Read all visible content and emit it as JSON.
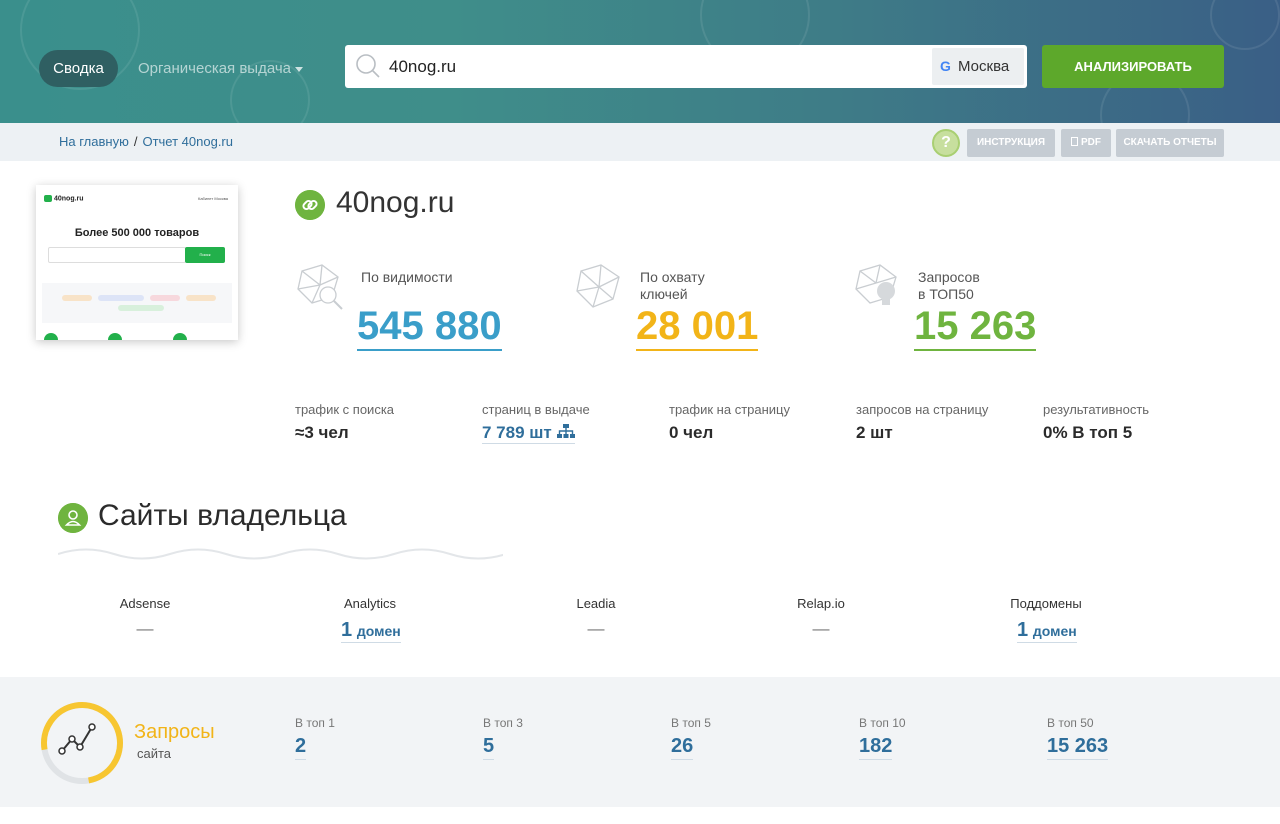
{
  "header": {
    "tab_summary": "Сводка",
    "tab_organic": "Органическая выдача",
    "search_value": "40nog.ru",
    "region_label": "Москва",
    "analyze_label": "АНАЛИЗИРОВАТЬ"
  },
  "breadcrumbs": {
    "home": "На главную",
    "separator": "/",
    "current": "Отчет 40nog.ru"
  },
  "toolbar": {
    "help": "?",
    "instruction": "ИНСТРУКЦИЯ",
    "pdf": "PDF",
    "download": "СКАЧАТЬ ОТЧЕТЫ"
  },
  "preview": {
    "logo": "40nog.ru",
    "cabinet": "Кабинет",
    "city": "Москва",
    "headline": "Более 500 000 товаров",
    "search_button": "Поиск"
  },
  "site": {
    "title": "40nog.ru"
  },
  "metrics": [
    {
      "label": "По видимости",
      "value": "545 880",
      "color": "#3a9ec9",
      "icon": "network-search-icon"
    },
    {
      "label": "По охвату\nключей",
      "value": "28 001",
      "color": "#f2b418",
      "icon": "network-icon"
    },
    {
      "label": "Запросов\nв ТОП50",
      "value": "15 263",
      "color": "#6fb43f",
      "icon": "network-bulb-icon"
    }
  ],
  "stats": [
    {
      "label": "трафик с поиска",
      "value": "≈3 чел"
    },
    {
      "label": "страниц в выдаче",
      "value": "7 789 шт"
    },
    {
      "label": "трафик на страницу",
      "value": "0 чел"
    },
    {
      "label": "запросов на страницу",
      "value": "2 шт"
    },
    {
      "label": "результативность",
      "value": "0% В топ 5"
    }
  ],
  "owner": {
    "title": "Сайты владельца",
    "items": [
      {
        "label": "Adsense",
        "value": "—"
      },
      {
        "label": "Analytics",
        "num": "1",
        "unit": "домен"
      },
      {
        "label": "Leadia",
        "value": "—"
      },
      {
        "label": "Relap.io",
        "value": "—"
      },
      {
        "label": "Поддомены",
        "num": "1",
        "unit": "домен"
      }
    ]
  },
  "queries": {
    "title": "Запросы",
    "subtitle": "сайта",
    "items": [
      {
        "label": "В топ 1",
        "value": "2"
      },
      {
        "label": "В топ 3",
        "value": "5"
      },
      {
        "label": "В топ 5",
        "value": "26"
      },
      {
        "label": "В топ 10",
        "value": "182"
      },
      {
        "label": "В топ 50",
        "value": "15 263"
      }
    ]
  },
  "colors": {
    "accent_green": "#5da82b",
    "link_blue": "#2f6e9b",
    "visibility_blue": "#3a9ec9",
    "coverage_yellow": "#f2b418",
    "top50_green": "#6fb43f"
  }
}
